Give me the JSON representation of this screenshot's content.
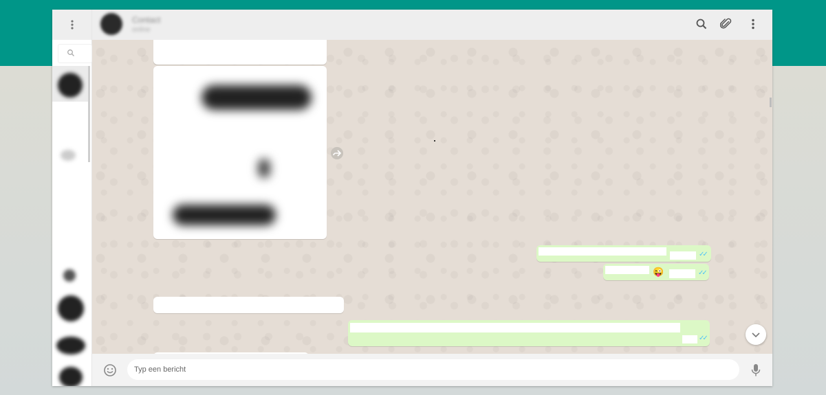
{
  "header": {
    "contact_name": "Contact",
    "contact_status": "online"
  },
  "messages": [
    {
      "direction": "in",
      "type": "text",
      "text": ""
    },
    {
      "direction": "in",
      "type": "image"
    },
    {
      "direction": "out",
      "type": "text",
      "text": "",
      "ticks": "✓✓"
    },
    {
      "direction": "out",
      "type": "text",
      "text": "😜",
      "ticks": "✓✓"
    },
    {
      "direction": "in",
      "type": "text",
      "text": ""
    },
    {
      "direction": "out",
      "type": "text",
      "text": "",
      "ticks": "✓✓"
    },
    {
      "direction": "in",
      "type": "text",
      "text": "😂😂😂😂"
    }
  ],
  "composer": {
    "placeholder": "Typ een bericht"
  },
  "icons": {
    "sidebar_menu": "kebab-menu-icon",
    "search": "search-icon",
    "attach": "paperclip-icon",
    "menu": "kebab-menu-icon",
    "emoji": "emoji-icon",
    "mic": "microphone-icon",
    "forward": "forward-icon",
    "scroll_down": "chevron-down-icon"
  },
  "colors": {
    "brand": "#009688",
    "outgoing_bubble": "#dcf8c6",
    "chat_background": "#e5ddd5",
    "read_ticks": "#4fc3f7"
  }
}
